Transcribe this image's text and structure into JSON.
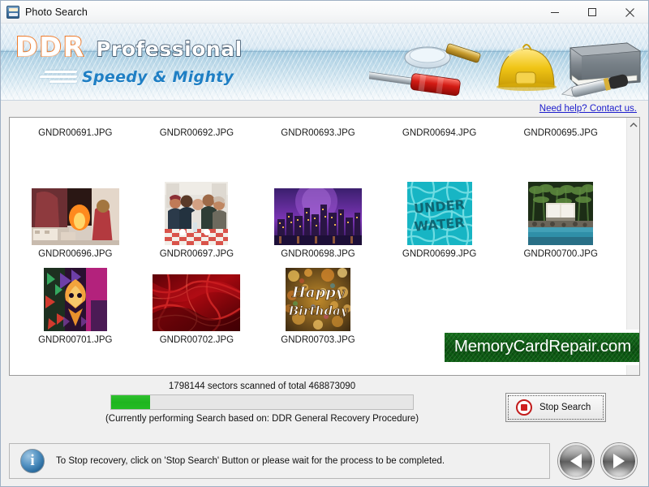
{
  "window": {
    "title": "Photo Search",
    "app_icon": "photo-card-icon",
    "minimize_label": "Minimize",
    "maximize_label": "Maximize",
    "close_label": "Close"
  },
  "banner": {
    "brand": "DDR",
    "edition": "Professional",
    "tagline": "Speedy & Mighty",
    "artwork": [
      "magnifier-icon",
      "screwdriver-icon",
      "hardhat-icon",
      "external-drive-icon",
      "pen-icon"
    ],
    "brand_color": "#f07a29",
    "tagline_color": "#1f7fc4"
  },
  "help": {
    "link_text": "Need help? Contact us."
  },
  "file_list": {
    "row_labels_top": [
      "GNDR00691.JPG",
      "GNDR00692.JPG",
      "GNDR00693.JPG",
      "GNDR00694.JPG",
      "GNDR00695.JPG"
    ],
    "row_middle": [
      {
        "name": "GNDR00696.JPG",
        "thumb": "fireplace-christmas-photo",
        "shape": "wide"
      },
      {
        "name": "GNDR00697.JPG",
        "thumb": "friends-at-table-photo",
        "shape": "tall"
      },
      {
        "name": "GNDR00698.JPG",
        "thumb": "city-skyline-purple-photo",
        "shape": "wide"
      },
      {
        "name": "GNDR00699.JPG",
        "thumb": "under-water-pool-photo",
        "shape": "sq"
      },
      {
        "name": "GNDR00700.JPG",
        "thumb": "palm-trees-poolside-photo",
        "shape": "sq"
      }
    ],
    "row_bottom": [
      {
        "name": "GNDR00701.JPG",
        "thumb": "abstract-fractal-photo",
        "shape": "tall"
      },
      {
        "name": "GNDR00702.JPG",
        "thumb": "red-silk-fabric-photo",
        "shape": "wide"
      },
      {
        "name": "GNDR00703.JPG",
        "thumb": "happy-birthday-bokeh-photo",
        "shape": "sq"
      }
    ],
    "scrollbar": {
      "up_arrow": "chevron-up-icon"
    }
  },
  "watermark": {
    "text": "MemoryCardRepair.com",
    "background_color": "#0d5a14",
    "text_color": "#ffffff"
  },
  "progress": {
    "status_text": "1798144 sectors scanned of total 468873090",
    "sectors_scanned": 1798144,
    "sectors_total": 468873090,
    "percent": 13,
    "fill_color": "#1eb51e",
    "procedure_text": "(Currently performing Search based on:  DDR General Recovery Procedure)",
    "stop_button_label": "Stop Search",
    "stop_button_icon": "stop-circle-icon"
  },
  "footer": {
    "info_icon": "info-circle-icon",
    "info_text": "To Stop recovery, click on 'Stop Search' Button or please wait for the process to be completed.",
    "back_button": "back-arrow-icon",
    "forward_button": "forward-arrow-icon"
  }
}
